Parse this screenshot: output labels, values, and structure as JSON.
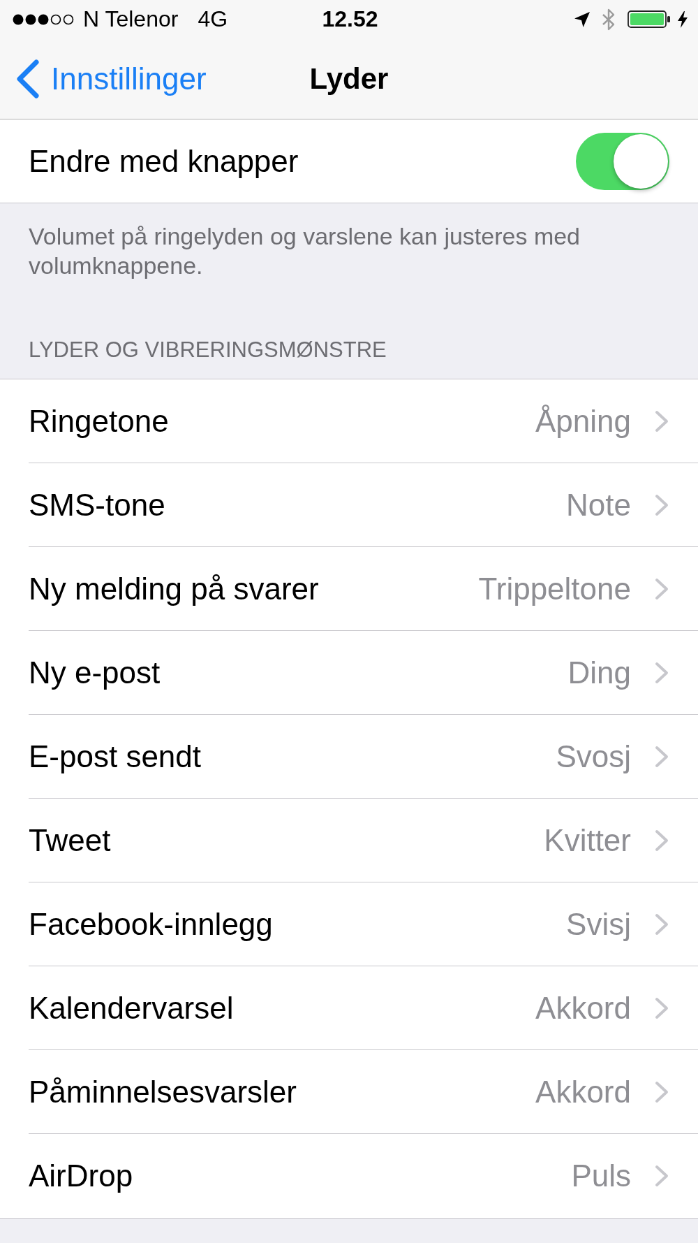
{
  "status_bar": {
    "carrier": "N Telenor",
    "network": "4G",
    "time": "12.52"
  },
  "nav_bar": {
    "back": "Innstillinger",
    "title": "Lyder"
  },
  "toggle_row": {
    "label": "Endre med knapper",
    "on": true
  },
  "footer": "Volumet på ringelyden og varslene kan justeres med volumknappene.",
  "sounds": {
    "header": "LYDER OG VIBRERINGSMØNSTRE",
    "rows": [
      {
        "label": "Ringetone",
        "value": "Åpning"
      },
      {
        "label": "SMS-tone",
        "value": "Note"
      },
      {
        "label": "Ny melding på svarer",
        "value": "Trippeltone"
      },
      {
        "label": "Ny e-post",
        "value": "Ding"
      },
      {
        "label": "E-post sendt",
        "value": "Svosj"
      },
      {
        "label": "Tweet",
        "value": "Kvitter"
      },
      {
        "label": "Facebook-innlegg",
        "value": "Svisj"
      },
      {
        "label": "Kalendervarsel",
        "value": "Akkord"
      },
      {
        "label": "Påminnelsesvarsler",
        "value": "Akkord"
      },
      {
        "label": "AirDrop",
        "value": "Puls"
      }
    ]
  }
}
